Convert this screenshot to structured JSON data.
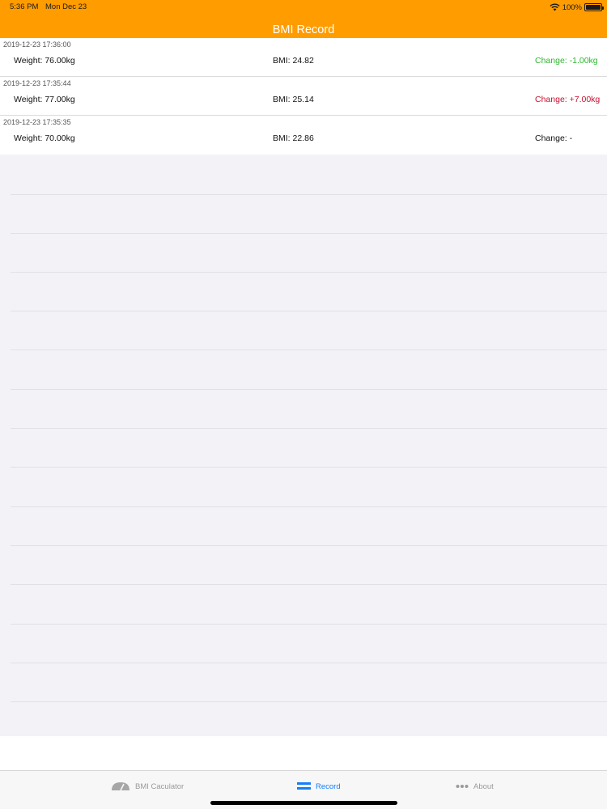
{
  "status_bar": {
    "time": "5:36 PM",
    "date": "Mon Dec 23",
    "battery": "100%"
  },
  "nav": {
    "title": "BMI Record"
  },
  "records": [
    {
      "date": "2019-12-23 17:36:00",
      "weight": "Weight: 76.00kg",
      "bmi": "BMI: 24.82",
      "change": "Change: -1.00kg"
    },
    {
      "date": "2019-12-23 17:35:44",
      "weight": "Weight: 77.00kg",
      "bmi": "BMI: 25.14",
      "change": "Change: +7.00kg"
    },
    {
      "date": "2019-12-23 17:35:35",
      "weight": "Weight: 70.00kg",
      "bmi": "BMI: 22.86",
      "change": "Change: -"
    }
  ],
  "colors": {
    "nav_background": "#ff9c00",
    "change_decrease": "#2eb82e",
    "change_increase": "#c8102e",
    "tab_active": "#147efb"
  },
  "tabs": [
    {
      "label": "BMI Caculator",
      "icon": "gauge-icon",
      "active": false
    },
    {
      "label": "Record",
      "icon": "list-icon",
      "active": true
    },
    {
      "label": "About",
      "icon": "more-icon",
      "active": false
    }
  ]
}
